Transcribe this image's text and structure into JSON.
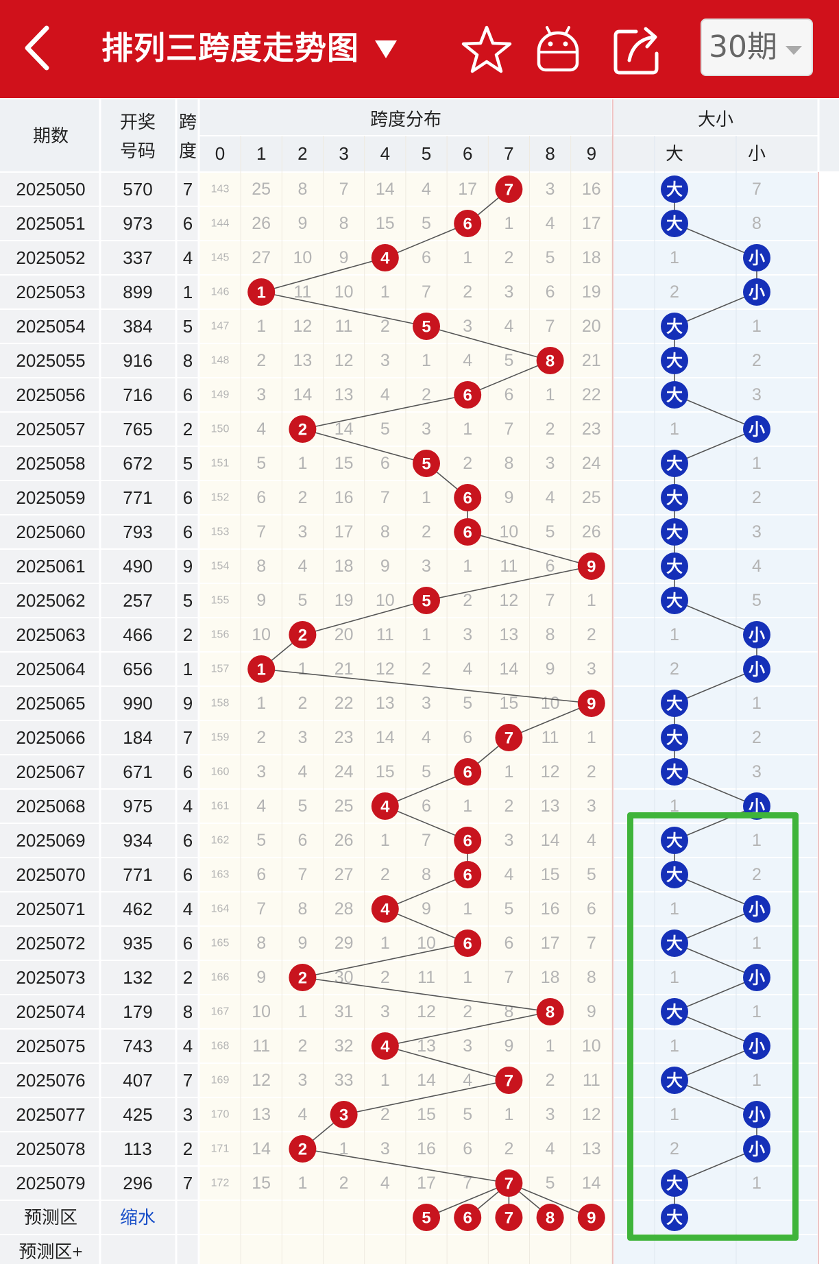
{
  "header": {
    "title": "排列三跨度走势图",
    "period_selector": "30期",
    "icons": [
      "back-arrow-icon",
      "dropdown-triangle-icon",
      "star-icon",
      "android-robot-icon",
      "share-icon",
      "chevron-down-icon"
    ]
  },
  "colors": {
    "header_bg": "#d0111b",
    "hit_ball": "#c8141e",
    "big_small_ball": "#1530b8",
    "line": "#555555",
    "highlight_border": "#3fb43a",
    "miss_text": "#b4b4b4"
  },
  "table": {
    "header_row1": [
      "期数",
      "开奖",
      "跨",
      "跨度分布",
      "大小"
    ],
    "header_row2": [
      "号码",
      "度"
    ],
    "span_columns": [
      "0",
      "1",
      "2",
      "3",
      "4",
      "5",
      "6",
      "7",
      "8",
      "9"
    ],
    "size_columns": [
      "大",
      "小"
    ],
    "rows": [
      {
        "issue": "2025050",
        "num": "570",
        "span": 7,
        "miss": [
          143,
          25,
          8,
          7,
          14,
          4,
          17,
          7,
          3,
          16
        ],
        "bigsmall": [
          "大",
          "7"
        ]
      },
      {
        "issue": "2025051",
        "num": "973",
        "span": 6,
        "miss": [
          144,
          26,
          9,
          8,
          15,
          5,
          6,
          1,
          4,
          17
        ],
        "bigsmall": [
          "大",
          "8"
        ]
      },
      {
        "issue": "2025052",
        "num": "337",
        "span": 4,
        "miss": [
          145,
          27,
          10,
          9,
          4,
          6,
          1,
          2,
          5,
          18
        ],
        "bigsmall": [
          "1",
          "小"
        ]
      },
      {
        "issue": "2025053",
        "num": "899",
        "span": 1,
        "miss": [
          146,
          1,
          11,
          10,
          1,
          7,
          2,
          3,
          6,
          19
        ],
        "bigsmall": [
          "2",
          "小"
        ]
      },
      {
        "issue": "2025054",
        "num": "384",
        "span": 5,
        "miss": [
          147,
          1,
          12,
          11,
          2,
          5,
          3,
          4,
          7,
          20
        ],
        "bigsmall": [
          "大",
          "1"
        ]
      },
      {
        "issue": "2025055",
        "num": "916",
        "span": 8,
        "miss": [
          148,
          2,
          13,
          12,
          3,
          1,
          4,
          5,
          8,
          21
        ],
        "bigsmall": [
          "大",
          "2"
        ]
      },
      {
        "issue": "2025056",
        "num": "716",
        "span": 6,
        "miss": [
          149,
          3,
          14,
          13,
          4,
          2,
          6,
          6,
          1,
          22
        ],
        "bigsmall": [
          "大",
          "3"
        ]
      },
      {
        "issue": "2025057",
        "num": "765",
        "span": 2,
        "miss": [
          150,
          4,
          2,
          14,
          5,
          3,
          1,
          7,
          2,
          23
        ],
        "bigsmall": [
          "1",
          "小"
        ]
      },
      {
        "issue": "2025058",
        "num": "672",
        "span": 5,
        "miss": [
          151,
          5,
          1,
          15,
          6,
          5,
          2,
          8,
          3,
          24
        ],
        "bigsmall": [
          "大",
          "1"
        ]
      },
      {
        "issue": "2025059",
        "num": "771",
        "span": 6,
        "miss": [
          152,
          6,
          2,
          16,
          7,
          1,
          6,
          9,
          4,
          25
        ],
        "bigsmall": [
          "大",
          "2"
        ]
      },
      {
        "issue": "2025060",
        "num": "793",
        "span": 6,
        "miss": [
          153,
          7,
          3,
          17,
          8,
          2,
          6,
          10,
          5,
          26
        ],
        "bigsmall": [
          "大",
          "3"
        ]
      },
      {
        "issue": "2025061",
        "num": "490",
        "span": 9,
        "miss": [
          154,
          8,
          4,
          18,
          9,
          3,
          1,
          11,
          6,
          9
        ],
        "bigsmall": [
          "大",
          "4"
        ]
      },
      {
        "issue": "2025062",
        "num": "257",
        "span": 5,
        "miss": [
          155,
          9,
          5,
          19,
          10,
          5,
          2,
          12,
          7,
          1
        ],
        "bigsmall": [
          "大",
          "5"
        ]
      },
      {
        "issue": "2025063",
        "num": "466",
        "span": 2,
        "miss": [
          156,
          10,
          2,
          20,
          11,
          1,
          3,
          13,
          8,
          2
        ],
        "bigsmall": [
          "1",
          "小"
        ]
      },
      {
        "issue": "2025064",
        "num": "656",
        "span": 1,
        "miss": [
          157,
          1,
          1,
          21,
          12,
          2,
          4,
          14,
          9,
          3
        ],
        "bigsmall": [
          "2",
          "小"
        ]
      },
      {
        "issue": "2025065",
        "num": "990",
        "span": 9,
        "miss": [
          158,
          1,
          2,
          22,
          13,
          3,
          5,
          15,
          10,
          9
        ],
        "bigsmall": [
          "大",
          "1"
        ]
      },
      {
        "issue": "2025066",
        "num": "184",
        "span": 7,
        "miss": [
          159,
          2,
          3,
          23,
          14,
          4,
          6,
          7,
          11,
          1
        ],
        "bigsmall": [
          "大",
          "2"
        ]
      },
      {
        "issue": "2025067",
        "num": "671",
        "span": 6,
        "miss": [
          160,
          3,
          4,
          24,
          15,
          5,
          6,
          1,
          12,
          2
        ],
        "bigsmall": [
          "大",
          "3"
        ]
      },
      {
        "issue": "2025068",
        "num": "975",
        "span": 4,
        "miss": [
          161,
          4,
          5,
          25,
          4,
          6,
          1,
          2,
          13,
          3
        ],
        "bigsmall": [
          "1",
          "小"
        ]
      },
      {
        "issue": "2025069",
        "num": "934",
        "span": 6,
        "miss": [
          162,
          5,
          6,
          26,
          1,
          7,
          6,
          3,
          14,
          4
        ],
        "bigsmall": [
          "大",
          "1"
        ]
      },
      {
        "issue": "2025070",
        "num": "771",
        "span": 6,
        "miss": [
          163,
          6,
          7,
          27,
          2,
          8,
          6,
          4,
          15,
          5
        ],
        "bigsmall": [
          "大",
          "2"
        ]
      },
      {
        "issue": "2025071",
        "num": "462",
        "span": 4,
        "miss": [
          164,
          7,
          8,
          28,
          4,
          9,
          1,
          5,
          16,
          6
        ],
        "bigsmall": [
          "1",
          "小"
        ]
      },
      {
        "issue": "2025072",
        "num": "935",
        "span": 6,
        "miss": [
          165,
          8,
          9,
          29,
          1,
          10,
          6,
          6,
          17,
          7
        ],
        "bigsmall": [
          "大",
          "1"
        ]
      },
      {
        "issue": "2025073",
        "num": "132",
        "span": 2,
        "miss": [
          166,
          9,
          2,
          30,
          2,
          11,
          1,
          7,
          18,
          8
        ],
        "bigsmall": [
          "1",
          "小"
        ]
      },
      {
        "issue": "2025074",
        "num": "179",
        "span": 8,
        "miss": [
          167,
          10,
          1,
          31,
          3,
          12,
          2,
          8,
          8,
          9
        ],
        "bigsmall": [
          "大",
          "1"
        ]
      },
      {
        "issue": "2025075",
        "num": "743",
        "span": 4,
        "miss": [
          168,
          11,
          2,
          32,
          4,
          13,
          3,
          9,
          1,
          10
        ],
        "bigsmall": [
          "1",
          "小"
        ]
      },
      {
        "issue": "2025076",
        "num": "407",
        "span": 7,
        "miss": [
          169,
          12,
          3,
          33,
          1,
          14,
          4,
          7,
          2,
          11
        ],
        "bigsmall": [
          "大",
          "1"
        ]
      },
      {
        "issue": "2025077",
        "num": "425",
        "span": 3,
        "miss": [
          170,
          13,
          4,
          3,
          2,
          15,
          5,
          1,
          3,
          12
        ],
        "bigsmall": [
          "1",
          "小"
        ]
      },
      {
        "issue": "2025078",
        "num": "113",
        "span": 2,
        "miss": [
          171,
          14,
          2,
          1,
          3,
          16,
          6,
          2,
          4,
          13
        ],
        "bigsmall": [
          "2",
          "小"
        ]
      },
      {
        "issue": "2025079",
        "num": "296",
        "span": 7,
        "miss": [
          172,
          15,
          1,
          2,
          4,
          17,
          7,
          7,
          5,
          14
        ],
        "bigsmall": [
          "大",
          "1"
        ]
      }
    ],
    "predict_row": {
      "label": "预测区",
      "num_label": "缩水",
      "balls": [
        "5",
        "6",
        "7",
        "8",
        "9"
      ],
      "bigsmall": "大"
    },
    "predict_plus_row": {
      "label": "预测区+"
    }
  }
}
